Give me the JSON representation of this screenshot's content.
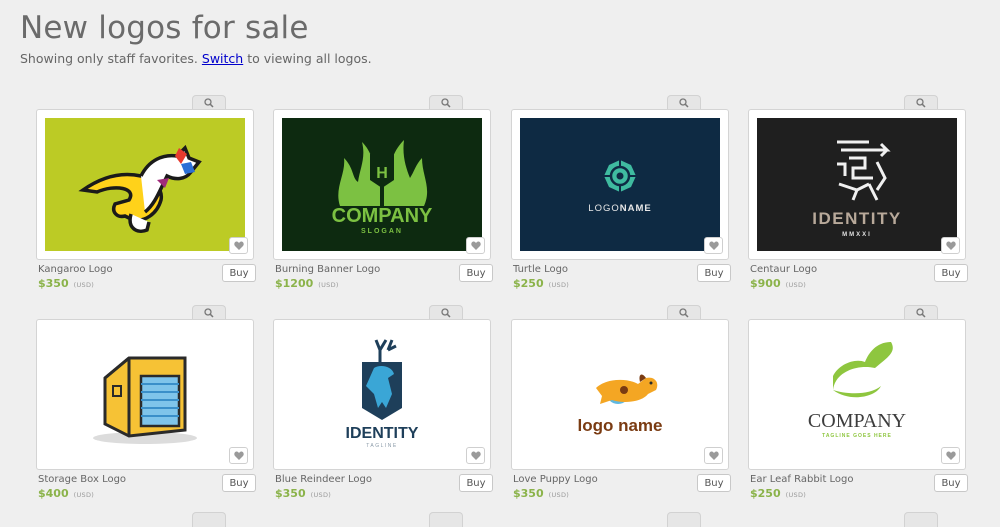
{
  "header": {
    "title": "New logos for sale",
    "subtitle_before": "Showing only staff favorites.",
    "switch_link": "Switch",
    "subtitle_after": "to viewing all logos."
  },
  "buy_label": "Buy",
  "currency_label": "(USD)",
  "logos": [
    {
      "name": "Kangaroo Logo",
      "price": "$350",
      "bg": "#bccb25"
    },
    {
      "name": "Burning Banner Logo",
      "price": "$1200",
      "bg": "#0d2a10",
      "wordmark": "COMPANY",
      "tagline": "SLOGAN",
      "monogram": "H"
    },
    {
      "name": "Turtle Logo",
      "price": "$250",
      "bg": "#0e2a43",
      "wordmark_light": "LOGO",
      "wordmark_bold": "NAME"
    },
    {
      "name": "Centaur Logo",
      "price": "$900",
      "bg": "#1f1f1f",
      "wordmark": "IDENTITY",
      "tagline": "MMXXI"
    },
    {
      "name": "Storage Box Logo",
      "price": "$400",
      "bg": "#ffffff"
    },
    {
      "name": "Blue Reindeer Logo",
      "price": "$350",
      "bg": "#ffffff",
      "wordmark": "IDENTITY",
      "tagline": "TAGLINE"
    },
    {
      "name": "Love Puppy Logo",
      "price": "$350",
      "bg": "#ffffff",
      "wordmark": "logo name"
    },
    {
      "name": "Ear Leaf Rabbit Logo",
      "price": "$250",
      "bg": "#ffffff",
      "wordmark": "COMPANY",
      "tagline": "TAGLINE GOES HERE"
    }
  ]
}
